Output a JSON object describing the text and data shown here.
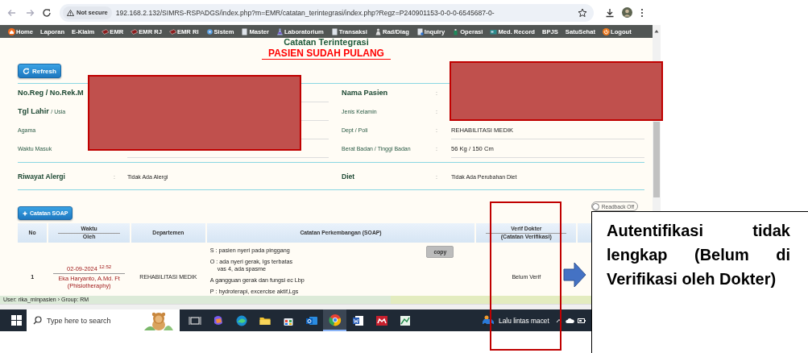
{
  "browser": {
    "security": "Not secure",
    "url": "192.168.2.132/SIMRS-RSPADGS/index.php?m=EMR/catatan_terintegrasi/index.php?Regz=P240901153-0-0-0-6545687-0-"
  },
  "menu": [
    {
      "label": "Home"
    },
    {
      "label": "Laporan"
    },
    {
      "label": "E-Klaim"
    },
    {
      "label": "EMR"
    },
    {
      "label": "EMR RJ"
    },
    {
      "label": "EMR RI"
    },
    {
      "label": "Sistem"
    },
    {
      "label": "Master"
    },
    {
      "label": "Laboratorium"
    },
    {
      "label": "Transaksi"
    },
    {
      "label": "Rad/Diag"
    },
    {
      "label": "Inquiry"
    },
    {
      "label": "Operasi"
    },
    {
      "label": "Med. Record"
    },
    {
      "label": "BPJS"
    },
    {
      "label": "SatuSehat"
    },
    {
      "label": "Logout"
    }
  ],
  "page": {
    "title": "Catatan Terintegrasi",
    "status": "PASIEN SUDAH PULANG",
    "refresh": "Refresh"
  },
  "patient_left": [
    {
      "label": "No.Reg / No.Rek.M",
      "kind": "heading"
    },
    {
      "label": "Tgl Lahir",
      "sub": "/ Usia",
      "kind": "heading"
    },
    {
      "label": "Agama",
      "kind": "plain"
    },
    {
      "label": "Waktu Masuk",
      "kind": "plain"
    }
  ],
  "patient_right": [
    {
      "label": "Nama Pasien",
      "kind": "heading",
      "colon": ":"
    },
    {
      "label": "Jenis Kelamin",
      "kind": "plain",
      "colon": ":"
    },
    {
      "label": "Dept / Poli",
      "kind": "plain",
      "colon": ":",
      "value": "REHABILITASI MEDIK"
    },
    {
      "label": "Berat Badan / Tinggi Badan",
      "kind": "plain",
      "colon": ":",
      "value": "56 Kg / 150 Cm"
    }
  ],
  "extra": [
    {
      "label": "Riwayat Alergi",
      "colon": ":",
      "value": "Tidak Ada Alergi"
    },
    {
      "label": "Diet",
      "colon": ":",
      "value": "Tidak Ada Perubahan Diet"
    }
  ],
  "soap_button": "Catatan SOAP",
  "readback": {
    "label": "Readback Off",
    "on": false
  },
  "table": {
    "columns": [
      {
        "label": "No"
      },
      {
        "label": "Waktu",
        "sublabel": "Oleh"
      },
      {
        "label": "Departemen"
      },
      {
        "label": "Catatan Perkembangan (SOAP)"
      },
      {
        "label": "Verif Dokter",
        "sublabel": "(Catatan Verifikasi)"
      }
    ],
    "rows": [
      {
        "no": "1",
        "when": "02-09-2024 $^{12:52}$",
        "author": "Eka Haryanto, A.Md. Ft",
        "role": "(Phisiotheraphy)",
        "department": "REHABILITASI MEDIK",
        "soap": [
          {
            "lines": [
              "S : pasien nyeri pada pinggang"
            ]
          },
          {
            "lines": [
              "O : ada nyeri gerak, lgs terbatas",
              "vas 4, ada spasme"
            ]
          },
          {
            "lines": [
              "A  gangguan gerak dan fungsi ec Lbp"
            ]
          },
          {
            "lines": [
              "P : hydroterapi, excercise aktif,Lgs"
            ]
          }
        ],
        "copy": "copy",
        "verification": "Belum Verif"
      }
    ]
  },
  "status_bar": "User: rika_minpasien › Group: RM",
  "taskbar": {
    "search_placeholder": "Type here to search",
    "traffic": "Lalu lintas macet",
    "apps": [
      {
        "active": false
      },
      {
        "active": false
      },
      {
        "active": false
      },
      {
        "active": false
      },
      {
        "active": false
      },
      {
        "active": false
      },
      {
        "active": true
      },
      {
        "active": false
      },
      {
        "active": false
      },
      {
        "active": false
      }
    ]
  },
  "annotation": {
    "callout": "Autentifikasi tidak lengkap (Belum di Verifikasi oleh Dokter)"
  }
}
